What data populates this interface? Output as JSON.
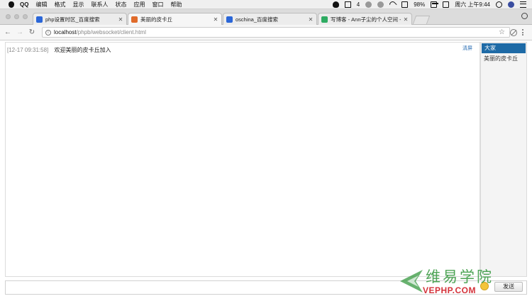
{
  "menubar": {
    "items": [
      "QQ",
      "编辑",
      "格式",
      "显示",
      "联系人",
      "状态",
      "应用",
      "窗口",
      "帮助"
    ],
    "qq_badge": "4",
    "battery": "98%",
    "clock": "周六 上午9:44"
  },
  "tabs": [
    {
      "label": "php设置时区_百度搜索",
      "favicon": "baidu-icon",
      "active": false
    },
    {
      "label": "美丽的皮卡丘",
      "favicon": "orange-icon",
      "active": true
    },
    {
      "label": "oschina_百度搜索",
      "favicon": "baidu-icon",
      "active": false
    },
    {
      "label": "写博客 - Ann子尘的个人空间 -",
      "favicon": "green-icon",
      "active": false
    }
  ],
  "address": {
    "host": "localhost",
    "path": "/phpb/websocket/client.html"
  },
  "chat": {
    "messages": [
      {
        "time": "[12-17 09:31:58]",
        "text": "欢迎美丽的皮卡丘加入"
      }
    ],
    "clear_label": "清屏"
  },
  "users": {
    "items": [
      {
        "label": "大家",
        "selected": true
      },
      {
        "label": "美丽的皮卡丘",
        "selected": false
      }
    ]
  },
  "input": {
    "value": "",
    "send_label": "发送"
  },
  "watermark": {
    "cn": "维易学院",
    "en": "VEPHP.COM"
  },
  "colors": {
    "selected_user_bg": "#1e6aa6",
    "link_blue": "#2c6fb5",
    "watermark_green": "#3e9c47",
    "watermark_red": "#d1212a"
  }
}
